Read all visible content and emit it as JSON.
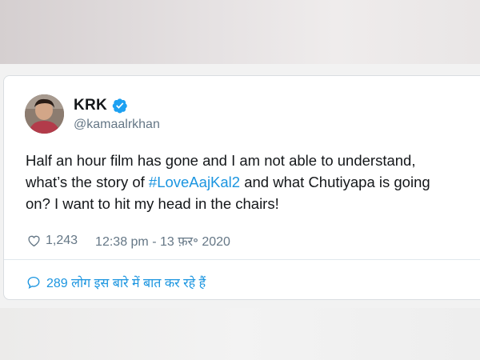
{
  "tweet": {
    "author": {
      "name": "KRK",
      "handle": "@kamaalrkhan",
      "verified": true
    },
    "text": {
      "line1": "Half an hour film has gone and I am not able to understand,",
      "line2_before": "what’s the story of ",
      "hashtag": "#LoveAajKal2",
      "line2_after": " and what Chutiyapa is going",
      "line3": "on? I want to hit my head in the chairs!"
    },
    "like_count": "1,243",
    "timestamp": "12:38 pm - 13 फ़र॰ 2020",
    "talking_about": "289 लोग इस बारे में बात कर रहे हैं"
  },
  "colors": {
    "link": "#1b95e0",
    "text": "#14171a",
    "muted": "#657786",
    "verified": "#1da1f2"
  },
  "icons": {
    "verified": "verified-badge-icon",
    "like": "heart-icon",
    "reply": "speech-bubble-icon"
  }
}
